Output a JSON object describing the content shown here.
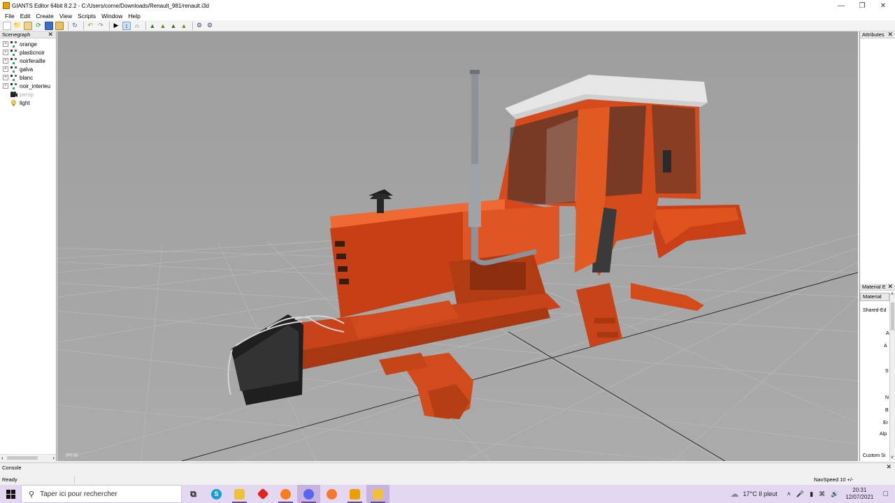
{
  "window": {
    "title": "GIANTS Editor 64bit 8.2.2 - C:/Users/corne/Downloads/Renault_981/renault.i3d"
  },
  "menu": [
    "File",
    "Edit",
    "Create",
    "View",
    "Scripts",
    "Window",
    "Help"
  ],
  "scenegraph": {
    "title": "Scenegraph",
    "nodes": [
      {
        "label": "orange",
        "expandable": true,
        "icon": "transform-group-icon"
      },
      {
        "label": "plasticnoir",
        "expandable": true,
        "icon": "transform-group-icon"
      },
      {
        "label": "noirferaille",
        "expandable": true,
        "icon": "transform-group-icon"
      },
      {
        "label": "galva",
        "expandable": true,
        "icon": "transform-group-icon"
      },
      {
        "label": "blanc",
        "expandable": true,
        "icon": "transform-group-icon"
      },
      {
        "label": "noir_interieu",
        "expandable": true,
        "icon": "transform-group-icon"
      },
      {
        "label": "persp",
        "expandable": false,
        "icon": "camera-icon",
        "dim": true
      },
      {
        "label": "light",
        "expandable": false,
        "icon": "light-bulb-icon"
      }
    ]
  },
  "viewport": {
    "camera_label": "persp"
  },
  "attributes": {
    "title": "Attributes"
  },
  "material_editor": {
    "title": "Material E",
    "tab": "Material",
    "shared": "Shared-Ed",
    "fields": [
      "A",
      "A",
      "S",
      "N",
      "B",
      "Er",
      "Alp",
      "Custom Si"
    ]
  },
  "console": {
    "title": "Console"
  },
  "status": {
    "text": "Ready",
    "navspeed": "NavSpeed 10 +/-"
  },
  "taskbar": {
    "search_placeholder": "Taper ici pour rechercher",
    "weather": "17°C  Il pleut",
    "time": "20:31",
    "date": "12/07/2021"
  },
  "colors": {
    "viewport_bg": "#a4a4a4",
    "tractor_orange": "#d8461c",
    "taskbar_bg": "#e4d7f1"
  }
}
